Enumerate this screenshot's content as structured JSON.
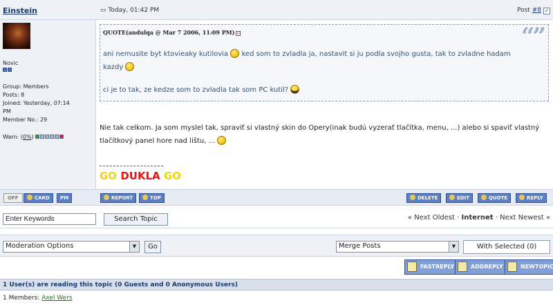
{
  "post": {
    "author": "Einstein",
    "time": "Today, 01:42 PM",
    "post_label": "Post",
    "post_number": "#8",
    "rank": "Novic",
    "group": "Group: Members",
    "posts": "Posts: 8",
    "joined_1": "Joined: Yesterday, 07:14",
    "joined_2": "PM",
    "member_no": "Member No.: 29",
    "warn_label": "Warn: (",
    "warn_value": "0%",
    "warn_close": ")"
  },
  "quote": {
    "title": "QUOTE(andulqa @ Mar 7 2006, 11:09 PM)",
    "line1": "ani nemusite byt ktovieaky kutilovia",
    "line1b": "ked som to zvladla ja, nastavit si ju podla svojho gusta, tak to zvladne hadam",
    "line2": "kazdy",
    "line3": "ci je to tak, ze kedze som to zvladla tak som PC kutil?"
  },
  "body": {
    "text": "Nie tak celkom. Ja som myslel tak, spraviť si vlastný skin do Opery(inak budú vyzerať tlačítka, menu, ...) alebo si spaviť vlastný tlačítkový panel hore nad lištu, ..."
  },
  "signature": {
    "go1": "GO",
    "dukla": "DUKLA",
    "go2": "GO",
    "color_go": "#f2d40c",
    "color_dukla": "#e41414"
  },
  "buttons": {
    "off": "OFF",
    "card": "CARD",
    "pm": "PM",
    "report": "REPORT",
    "top": "TOP",
    "delete": "DELETE",
    "edit": "EDIT",
    "quote": "QUOTE",
    "reply": "REPLY"
  },
  "search": {
    "placeholder": "Enter Keywords",
    "button": "Search Topic"
  },
  "nav": {
    "prev": "« Next Oldest",
    "sep1": "·",
    "current": "Internet",
    "sep2": "·",
    "next": "Next Newest »"
  },
  "moderation": {
    "selected": "Moderation Options",
    "go": "Go",
    "merge": "Merge Posts",
    "with_selected": "With Selected (0)"
  },
  "actions": {
    "fastreply": "FASTREPLY",
    "addreply": "ADDREPLY",
    "newtopic": "NEWTOPIC"
  },
  "reading": {
    "text": "1 User(s) are reading this topic (0 Guests and 0 Anonymous Users)"
  },
  "members": {
    "label": "1 Members:",
    "name": "Axel Wers"
  }
}
